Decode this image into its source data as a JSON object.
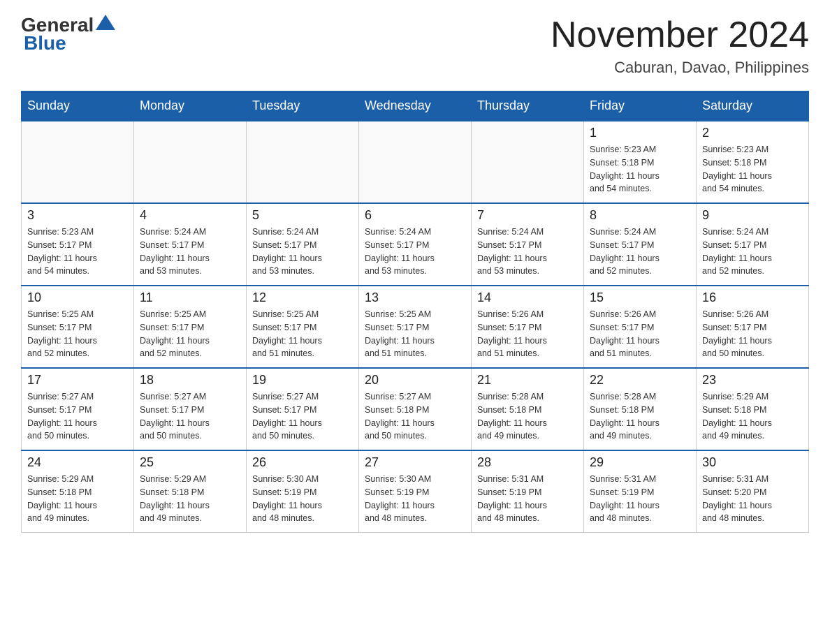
{
  "header": {
    "logo_general": "General",
    "logo_blue": "Blue",
    "title": "November 2024",
    "subtitle": "Caburan, Davao, Philippines"
  },
  "weekdays": [
    "Sunday",
    "Monday",
    "Tuesday",
    "Wednesday",
    "Thursday",
    "Friday",
    "Saturday"
  ],
  "weeks": [
    [
      {
        "day": "",
        "info": ""
      },
      {
        "day": "",
        "info": ""
      },
      {
        "day": "",
        "info": ""
      },
      {
        "day": "",
        "info": ""
      },
      {
        "day": "",
        "info": ""
      },
      {
        "day": "1",
        "info": "Sunrise: 5:23 AM\nSunset: 5:18 PM\nDaylight: 11 hours\nand 54 minutes."
      },
      {
        "day": "2",
        "info": "Sunrise: 5:23 AM\nSunset: 5:18 PM\nDaylight: 11 hours\nand 54 minutes."
      }
    ],
    [
      {
        "day": "3",
        "info": "Sunrise: 5:23 AM\nSunset: 5:17 PM\nDaylight: 11 hours\nand 54 minutes."
      },
      {
        "day": "4",
        "info": "Sunrise: 5:24 AM\nSunset: 5:17 PM\nDaylight: 11 hours\nand 53 minutes."
      },
      {
        "day": "5",
        "info": "Sunrise: 5:24 AM\nSunset: 5:17 PM\nDaylight: 11 hours\nand 53 minutes."
      },
      {
        "day": "6",
        "info": "Sunrise: 5:24 AM\nSunset: 5:17 PM\nDaylight: 11 hours\nand 53 minutes."
      },
      {
        "day": "7",
        "info": "Sunrise: 5:24 AM\nSunset: 5:17 PM\nDaylight: 11 hours\nand 53 minutes."
      },
      {
        "day": "8",
        "info": "Sunrise: 5:24 AM\nSunset: 5:17 PM\nDaylight: 11 hours\nand 52 minutes."
      },
      {
        "day": "9",
        "info": "Sunrise: 5:24 AM\nSunset: 5:17 PM\nDaylight: 11 hours\nand 52 minutes."
      }
    ],
    [
      {
        "day": "10",
        "info": "Sunrise: 5:25 AM\nSunset: 5:17 PM\nDaylight: 11 hours\nand 52 minutes."
      },
      {
        "day": "11",
        "info": "Sunrise: 5:25 AM\nSunset: 5:17 PM\nDaylight: 11 hours\nand 52 minutes."
      },
      {
        "day": "12",
        "info": "Sunrise: 5:25 AM\nSunset: 5:17 PM\nDaylight: 11 hours\nand 51 minutes."
      },
      {
        "day": "13",
        "info": "Sunrise: 5:25 AM\nSunset: 5:17 PM\nDaylight: 11 hours\nand 51 minutes."
      },
      {
        "day": "14",
        "info": "Sunrise: 5:26 AM\nSunset: 5:17 PM\nDaylight: 11 hours\nand 51 minutes."
      },
      {
        "day": "15",
        "info": "Sunrise: 5:26 AM\nSunset: 5:17 PM\nDaylight: 11 hours\nand 51 minutes."
      },
      {
        "day": "16",
        "info": "Sunrise: 5:26 AM\nSunset: 5:17 PM\nDaylight: 11 hours\nand 50 minutes."
      }
    ],
    [
      {
        "day": "17",
        "info": "Sunrise: 5:27 AM\nSunset: 5:17 PM\nDaylight: 11 hours\nand 50 minutes."
      },
      {
        "day": "18",
        "info": "Sunrise: 5:27 AM\nSunset: 5:17 PM\nDaylight: 11 hours\nand 50 minutes."
      },
      {
        "day": "19",
        "info": "Sunrise: 5:27 AM\nSunset: 5:17 PM\nDaylight: 11 hours\nand 50 minutes."
      },
      {
        "day": "20",
        "info": "Sunrise: 5:27 AM\nSunset: 5:18 PM\nDaylight: 11 hours\nand 50 minutes."
      },
      {
        "day": "21",
        "info": "Sunrise: 5:28 AM\nSunset: 5:18 PM\nDaylight: 11 hours\nand 49 minutes."
      },
      {
        "day": "22",
        "info": "Sunrise: 5:28 AM\nSunset: 5:18 PM\nDaylight: 11 hours\nand 49 minutes."
      },
      {
        "day": "23",
        "info": "Sunrise: 5:29 AM\nSunset: 5:18 PM\nDaylight: 11 hours\nand 49 minutes."
      }
    ],
    [
      {
        "day": "24",
        "info": "Sunrise: 5:29 AM\nSunset: 5:18 PM\nDaylight: 11 hours\nand 49 minutes."
      },
      {
        "day": "25",
        "info": "Sunrise: 5:29 AM\nSunset: 5:18 PM\nDaylight: 11 hours\nand 49 minutes."
      },
      {
        "day": "26",
        "info": "Sunrise: 5:30 AM\nSunset: 5:19 PM\nDaylight: 11 hours\nand 48 minutes."
      },
      {
        "day": "27",
        "info": "Sunrise: 5:30 AM\nSunset: 5:19 PM\nDaylight: 11 hours\nand 48 minutes."
      },
      {
        "day": "28",
        "info": "Sunrise: 5:31 AM\nSunset: 5:19 PM\nDaylight: 11 hours\nand 48 minutes."
      },
      {
        "day": "29",
        "info": "Sunrise: 5:31 AM\nSunset: 5:19 PM\nDaylight: 11 hours\nand 48 minutes."
      },
      {
        "day": "30",
        "info": "Sunrise: 5:31 AM\nSunset: 5:20 PM\nDaylight: 11 hours\nand 48 minutes."
      }
    ]
  ]
}
